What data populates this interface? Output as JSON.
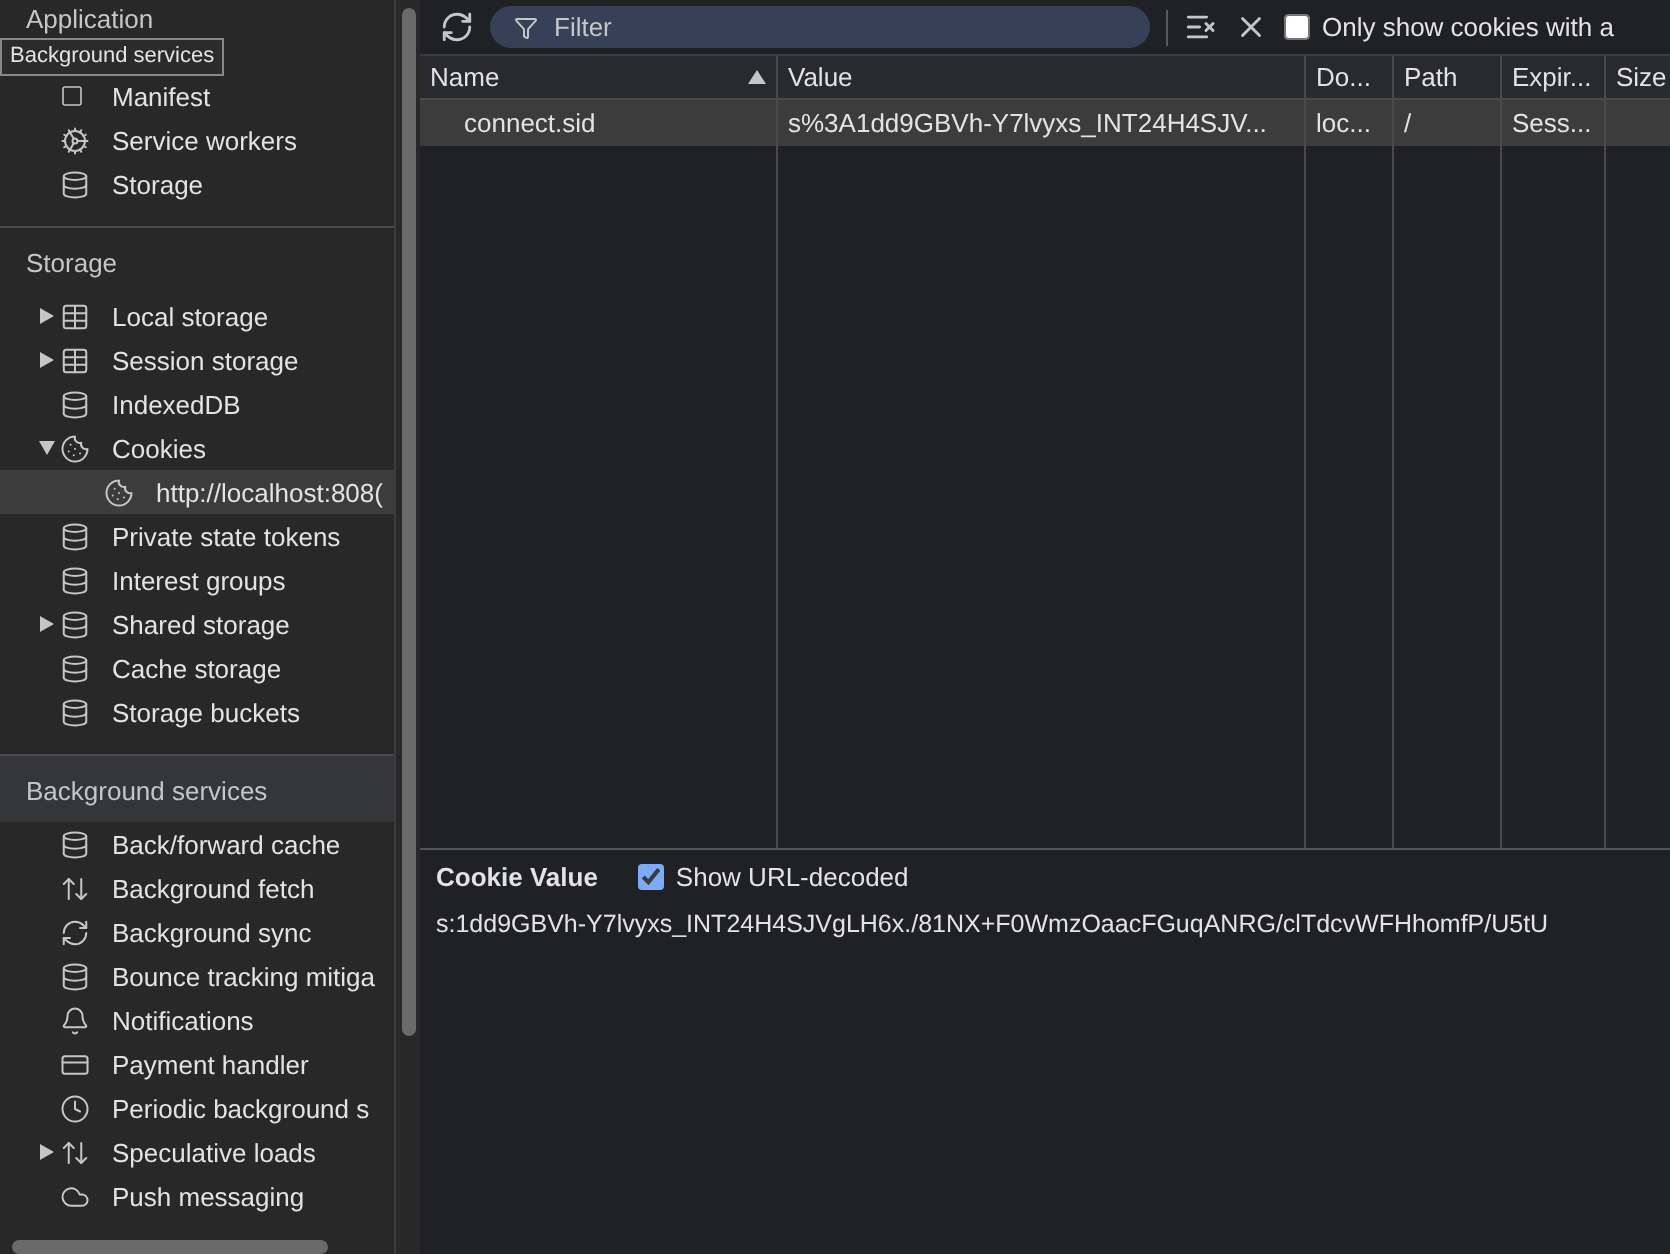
{
  "sidebar": {
    "sections": [
      {
        "title": "Application",
        "highlighted": false,
        "tooltip": "Background services",
        "items": [
          {
            "label": "Manifest",
            "kind": "file",
            "selected": false
          },
          {
            "label": "Service workers",
            "kind": "gears",
            "selected": false
          },
          {
            "label": "Storage",
            "kind": "database",
            "selected": false
          }
        ]
      },
      {
        "title": "Storage",
        "highlighted": false,
        "items": [
          {
            "label": "Local storage",
            "kind": "table",
            "expanded": false,
            "selected": false
          },
          {
            "label": "Session storage",
            "kind": "table",
            "expanded": false,
            "selected": false
          },
          {
            "label": "IndexedDB",
            "kind": "database",
            "selected": false
          },
          {
            "label": "Cookies",
            "kind": "cookie",
            "expanded": true,
            "selected": false,
            "children": [
              {
                "label": "http://localhost:808(",
                "kind": "cookie",
                "selected": true
              }
            ]
          },
          {
            "label": "Private state tokens",
            "kind": "database",
            "selected": false
          },
          {
            "label": "Interest groups",
            "kind": "database",
            "selected": false
          },
          {
            "label": "Shared storage",
            "kind": "database",
            "expanded": false,
            "selected": false
          },
          {
            "label": "Cache storage",
            "kind": "database",
            "selected": false
          },
          {
            "label": "Storage buckets",
            "kind": "database",
            "selected": false
          }
        ]
      },
      {
        "title": "Background services",
        "highlighted": true,
        "items": [
          {
            "label": "Back/forward cache",
            "kind": "database",
            "selected": false
          },
          {
            "label": "Background fetch",
            "kind": "updown",
            "selected": false
          },
          {
            "label": "Background sync",
            "kind": "sync",
            "selected": false
          },
          {
            "label": "Bounce tracking mitiga",
            "kind": "database",
            "selected": false
          },
          {
            "label": "Notifications",
            "kind": "bell",
            "selected": false
          },
          {
            "label": "Payment handler",
            "kind": "card",
            "selected": false
          },
          {
            "label": "Periodic background s",
            "kind": "clock",
            "selected": false
          },
          {
            "label": "Speculative loads",
            "kind": "updown",
            "expanded": false,
            "selected": false
          },
          {
            "label": "Push messaging",
            "kind": "cloud",
            "selected": false
          }
        ]
      }
    ]
  },
  "toolbar": {
    "filter": {
      "placeholder": "Filter"
    },
    "only_show_checkbox": {
      "label": "Only show cookies with a",
      "checked": false
    }
  },
  "table": {
    "columns": [
      {
        "label": "Name",
        "sorted": true
      },
      {
        "label": "Value",
        "sorted": false
      },
      {
        "label": "Do...",
        "sorted": false
      },
      {
        "label": "Path",
        "sorted": false
      },
      {
        "label": "Expir...",
        "sorted": false
      },
      {
        "label": "Size",
        "sorted": false
      }
    ],
    "rows": [
      {
        "selected": true,
        "cells": [
          "connect.sid",
          "s%3A1dd9GBVh-Y7lvyxs_INT24H4SJV...",
          "loc...",
          "/",
          "Sess...",
          ""
        ]
      }
    ]
  },
  "cookie_value": {
    "title": "Cookie Value",
    "decode_checkbox": {
      "label": "Show URL-decoded",
      "checked": true
    },
    "value": "s:1dd9GBVh-Y7lvyxs_INT24H4SJVgLH6x./81NX+F0WmzOaacFGuqANRG/clTdcvWFHhomfP/U5tU"
  }
}
